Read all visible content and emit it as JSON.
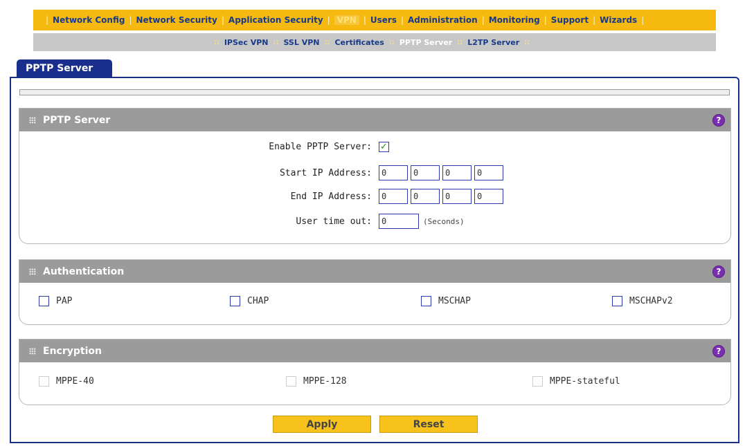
{
  "topnav": {
    "items": [
      {
        "label": "Network Config",
        "active": false
      },
      {
        "label": "Network Security",
        "active": false
      },
      {
        "label": "Application Security",
        "active": false
      },
      {
        "label": "VPN",
        "active": true
      },
      {
        "label": "Users",
        "active": false
      },
      {
        "label": "Administration",
        "active": false
      },
      {
        "label": "Monitoring",
        "active": false
      },
      {
        "label": "Support",
        "active": false
      },
      {
        "label": "Wizards",
        "active": false
      }
    ]
  },
  "subnav": {
    "separator": "::",
    "items": [
      {
        "label": "IPSec VPN",
        "active": false
      },
      {
        "label": "SSL VPN",
        "active": false
      },
      {
        "label": "Certificates",
        "active": false
      },
      {
        "label": "PPTP Server",
        "active": true
      },
      {
        "label": "L2TP Server",
        "active": false
      }
    ]
  },
  "page_tab": "PPTP Server",
  "pptp_section": {
    "title": "PPTP Server",
    "help": "?",
    "enable_label": "Enable PPTP Server:",
    "enable_checked": true,
    "start_ip_label": "Start IP Address:",
    "start_ip": [
      "0",
      "0",
      "0",
      "0"
    ],
    "end_ip_label": "End IP Address:",
    "end_ip": [
      "0",
      "0",
      "0",
      "0"
    ],
    "timeout_label": "User time out:",
    "timeout_value": "0",
    "timeout_unit": "(Seconds)"
  },
  "auth_section": {
    "title": "Authentication",
    "help": "?",
    "options": [
      {
        "label": "PAP",
        "checked": false
      },
      {
        "label": "CHAP",
        "checked": false
      },
      {
        "label": "MSCHAP",
        "checked": false
      },
      {
        "label": "MSCHAPv2",
        "checked": false
      }
    ]
  },
  "enc_section": {
    "title": "Encryption",
    "help": "?",
    "options": [
      {
        "label": "MPPE-40",
        "checked": false
      },
      {
        "label": "MPPE-128",
        "checked": false
      },
      {
        "label": "MPPE-stateful",
        "checked": false
      }
    ]
  },
  "buttons": {
    "apply": "Apply",
    "reset": "Reset"
  },
  "colors": {
    "nav_orange": "#f6b90f",
    "nav_blue_text": "#173a8a",
    "tab_blue": "#1a2f8d",
    "section_header_gray": "#9b9b9b",
    "help_purple": "#7a2fb2",
    "button_yellow": "#f6c21b"
  }
}
